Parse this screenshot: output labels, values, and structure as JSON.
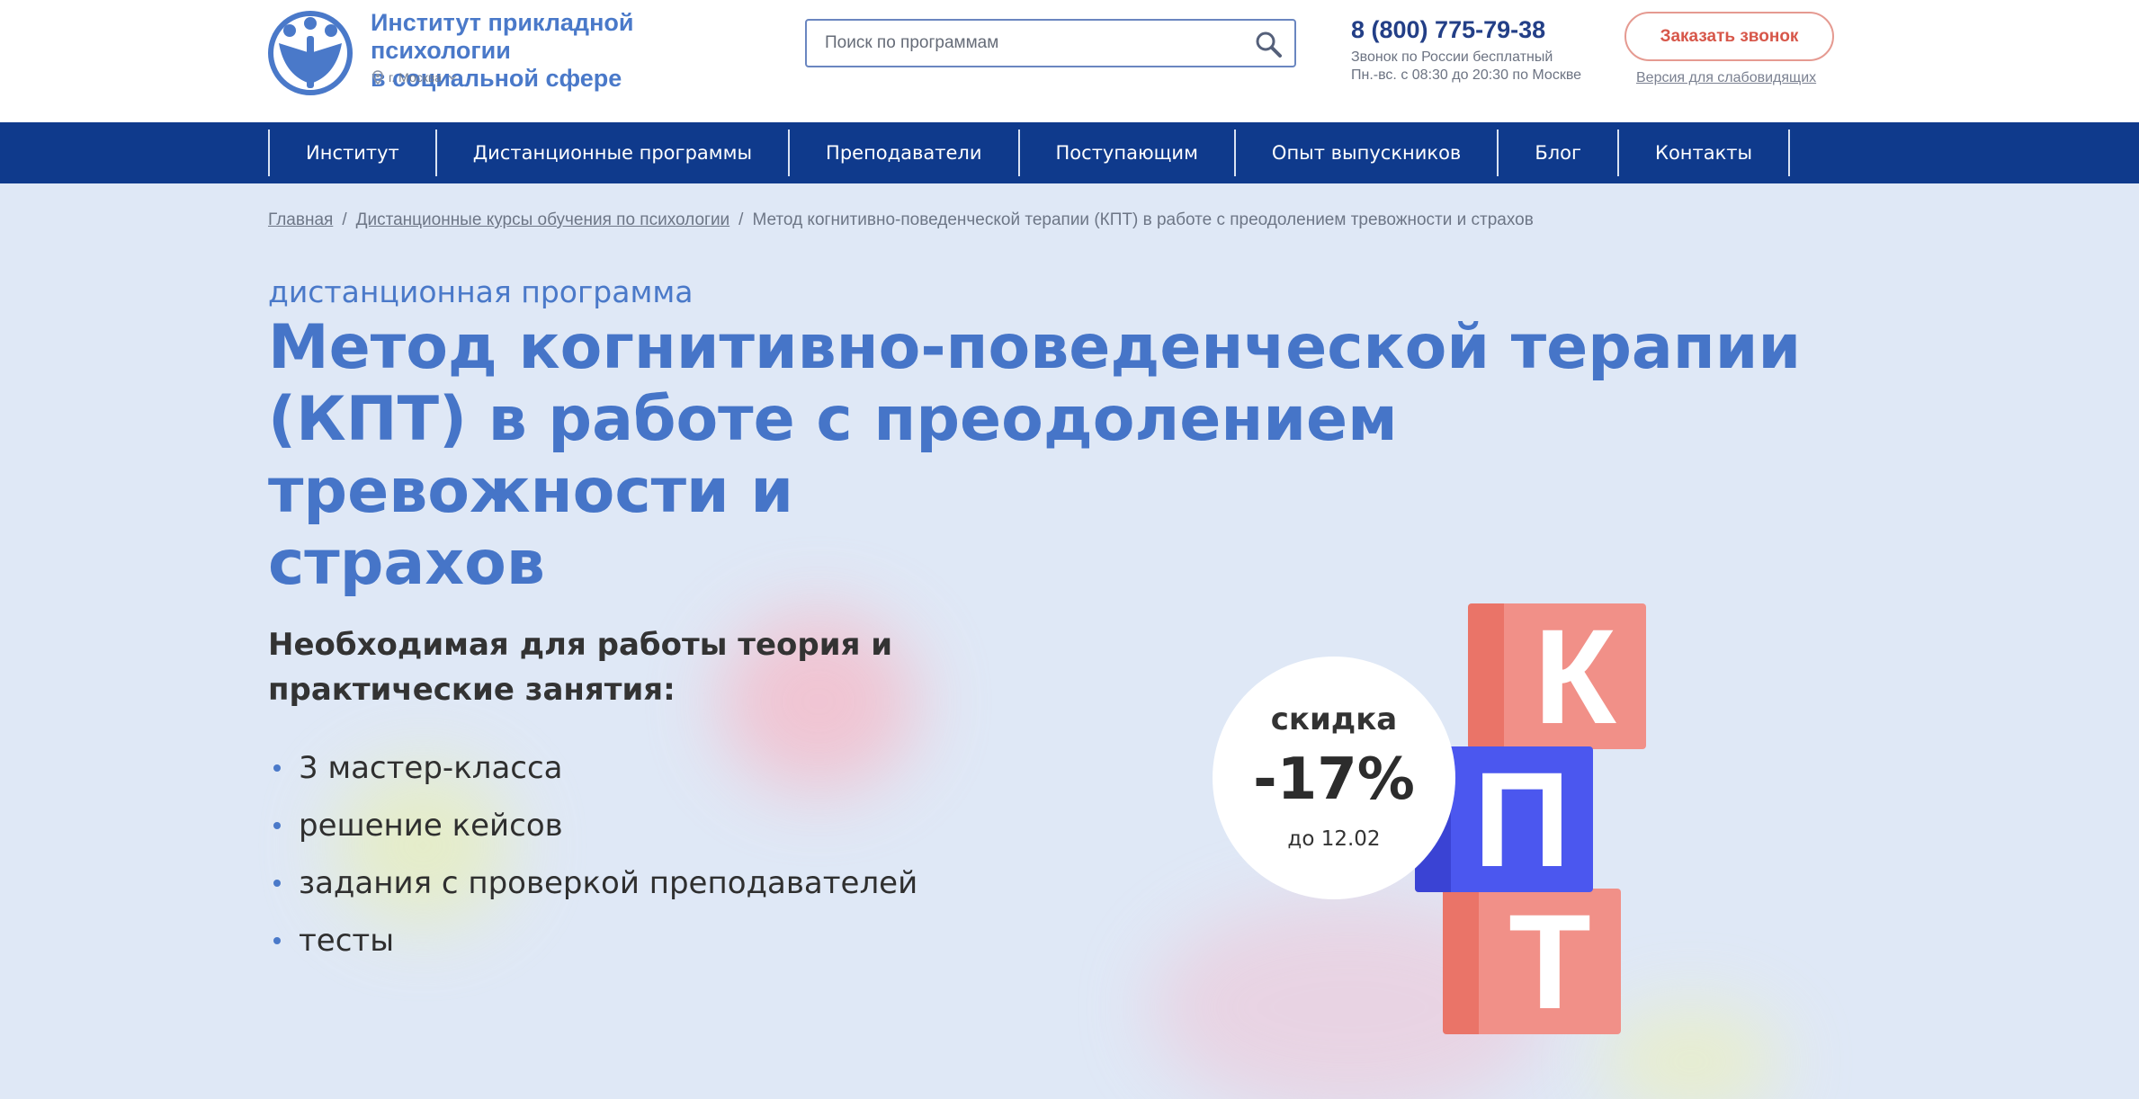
{
  "header": {
    "logo_title_line1": "Институт прикладной психологии",
    "logo_title_line2": "в социальной сфере",
    "city": "г. Москва",
    "search_placeholder": "Поиск по программам",
    "phone": "8 (800) 775-79-38",
    "phone_note_line1": "Звонок по России бесплатный",
    "phone_note_line2": "Пн.-вс. с 08:30 до 20:30 по Москве",
    "callback_label": "Заказать звонок",
    "impaired_label": "Версия для слабовидящих"
  },
  "nav": {
    "items": [
      {
        "label": "Институт"
      },
      {
        "label": "Дистанционные программы"
      },
      {
        "label": "Преподаватели"
      },
      {
        "label": "Поступающим"
      },
      {
        "label": "Опыт выпускников"
      },
      {
        "label": "Блог"
      },
      {
        "label": "Контакты"
      }
    ]
  },
  "breadcrumb": {
    "items": [
      {
        "label": "Главная"
      },
      {
        "label": "Дистанционные курсы обучения по психологии"
      },
      {
        "label": "Метод когнитивно-поведенческой терапии (КПТ) в работе с преодолением тревожности и страхов"
      }
    ],
    "separator": "/"
  },
  "hero": {
    "subtitle": "дистанционная программа",
    "title_line1": "Метод когнитивно-поведенческой терапии",
    "title_line2": "(КПТ) в работе с преодолением тревожности и",
    "title_line3": "страхов",
    "features_heading_line1": "Необходимая для работы теория и",
    "features_heading_line2": "практические занятия:",
    "features": [
      {
        "label": "3 мастер-класса"
      },
      {
        "label": "решение кейсов"
      },
      {
        "label": "задания с проверкой преподавателей"
      },
      {
        "label": "тесты"
      }
    ],
    "discount": {
      "label": "скидка",
      "value": "-17%",
      "until": "до 12.02"
    },
    "cubes": {
      "letter1": "К",
      "letter2": "П",
      "letter3": "Т"
    }
  },
  "colors": {
    "brand_blue": "#0f3a8c",
    "title_blue": "#4675c8",
    "cube_red": "#ef8a80",
    "cube_blue": "#4753e8",
    "background": "#dfe8f6"
  }
}
